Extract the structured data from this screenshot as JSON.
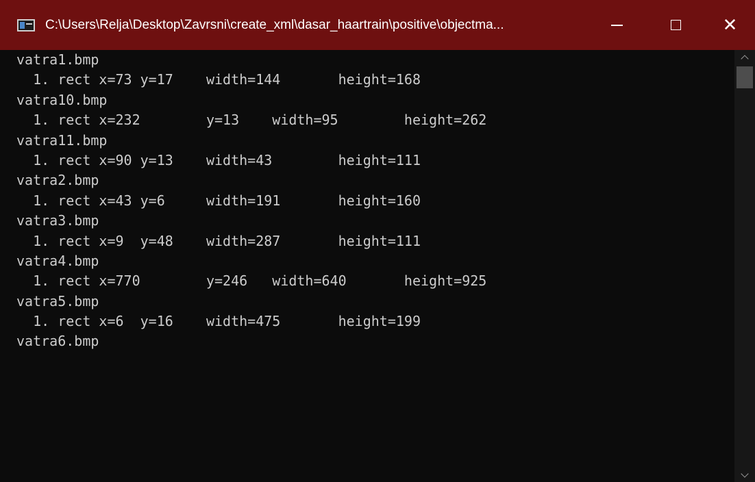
{
  "window": {
    "title": "C:\\Users\\Relja\\Desktop\\Zavrsni\\create_xml\\dasar_haartrain\\positive\\objectma...",
    "icon": "console-app-icon",
    "controls": {
      "minimize": "minimize-icon",
      "maximize": "maximize-icon",
      "close": "close-icon"
    },
    "colors": {
      "titlebar": "#6e1010",
      "background": "#0c0c0c",
      "text": "#cccccc"
    }
  },
  "console": {
    "lines": [
      "vatra1.bmp",
      "  1. rect x=73 y=17    width=144       height=168",
      "vatra10.bmp",
      "  1. rect x=232        y=13    width=95        height=262",
      "vatra11.bmp",
      "  1. rect x=90 y=13    width=43        height=111",
      "vatra2.bmp",
      "  1. rect x=43 y=6     width=191       height=160",
      "vatra3.bmp",
      "  1. rect x=9  y=48    width=287       height=111",
      "vatra4.bmp",
      "  1. rect x=770        y=246   width=640       height=925",
      "vatra5.bmp",
      "  1. rect x=6  y=16    width=475       height=199",
      "vatra6.bmp"
    ]
  },
  "scrollbar": {
    "up_icon": "chevron-up-icon",
    "down_icon": "chevron-down-icon"
  }
}
